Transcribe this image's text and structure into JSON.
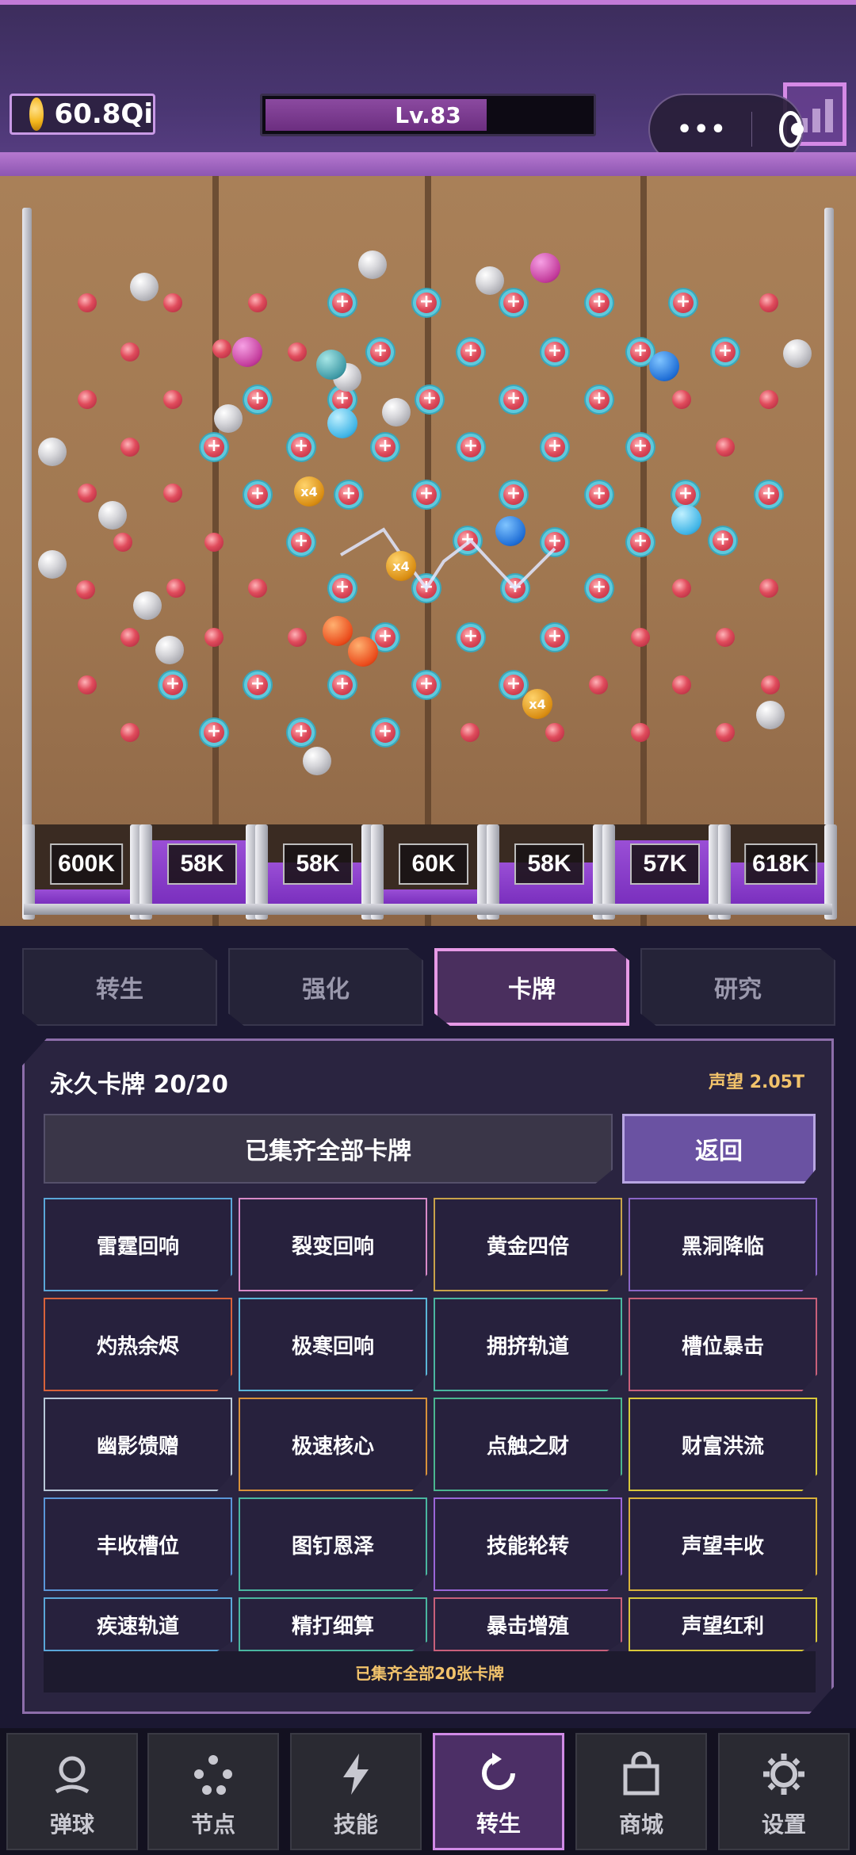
{
  "header": {
    "coin_value": "60.8Qi",
    "level_label": "Lv.83",
    "level_progress": 0.68,
    "capsule_more": "•••"
  },
  "buckets": [
    "600K",
    "58K",
    "58K",
    "60K",
    "58K",
    "57K",
    "618K"
  ],
  "board": {
    "multiplier_label": "x4"
  },
  "tabs": [
    {
      "label": "转生",
      "active": false
    },
    {
      "label": "强化",
      "active": false
    },
    {
      "label": "卡牌",
      "active": true
    },
    {
      "label": "研究",
      "active": false
    }
  ],
  "cards_panel": {
    "title": "永久卡牌  20/20",
    "prestige": "声望 2.05T",
    "collected_banner": "已集齐全部卡牌",
    "back_label": "返回",
    "footer": "已集齐全部20张卡牌",
    "cards": [
      {
        "label": "雷霆回响",
        "color": "#5aa6d8"
      },
      {
        "label": "裂变回响",
        "color": "#d88ac8"
      },
      {
        "label": "黄金四倍",
        "color": "#c8a24a"
      },
      {
        "label": "黑洞降临",
        "color": "#8a66c6"
      },
      {
        "label": "灼热余烬",
        "color": "#d8623a"
      },
      {
        "label": "极寒回响",
        "color": "#5ab6d8"
      },
      {
        "label": "拥挤轨道",
        "color": "#4ab6a0"
      },
      {
        "label": "槽位暴击",
        "color": "#c8607a"
      },
      {
        "label": "幽影馈赠",
        "color": "#b8c8d8"
      },
      {
        "label": "极速核心",
        "color": "#d8923a"
      },
      {
        "label": "点触之财",
        "color": "#4ab690"
      },
      {
        "label": "财富洪流",
        "color": "#d8c83a"
      },
      {
        "label": "丰收槽位",
        "color": "#5a96d8"
      },
      {
        "label": "图钉恩泽",
        "color": "#4ab6a0"
      },
      {
        "label": "技能轮转",
        "color": "#9a66d8"
      },
      {
        "label": "声望丰收",
        "color": "#d8b23a"
      },
      {
        "label": "疾速轨道",
        "color": "#5aa6d8"
      },
      {
        "label": "精打细算",
        "color": "#4ab6a0"
      },
      {
        "label": "暴击增殖",
        "color": "#c8607a"
      },
      {
        "label": "声望红利",
        "color": "#d8c83a"
      }
    ]
  },
  "bottom_nav": [
    {
      "label": "弹球",
      "icon": "pinball-icon",
      "active": false
    },
    {
      "label": "节点",
      "icon": "nodes-icon",
      "active": false
    },
    {
      "label": "技能",
      "icon": "lightning-icon",
      "active": false
    },
    {
      "label": "转生",
      "icon": "rebirth-icon",
      "active": true
    },
    {
      "label": "商城",
      "icon": "shop-bag-icon",
      "active": false
    },
    {
      "label": "设置",
      "icon": "gear-icon",
      "active": false
    }
  ]
}
